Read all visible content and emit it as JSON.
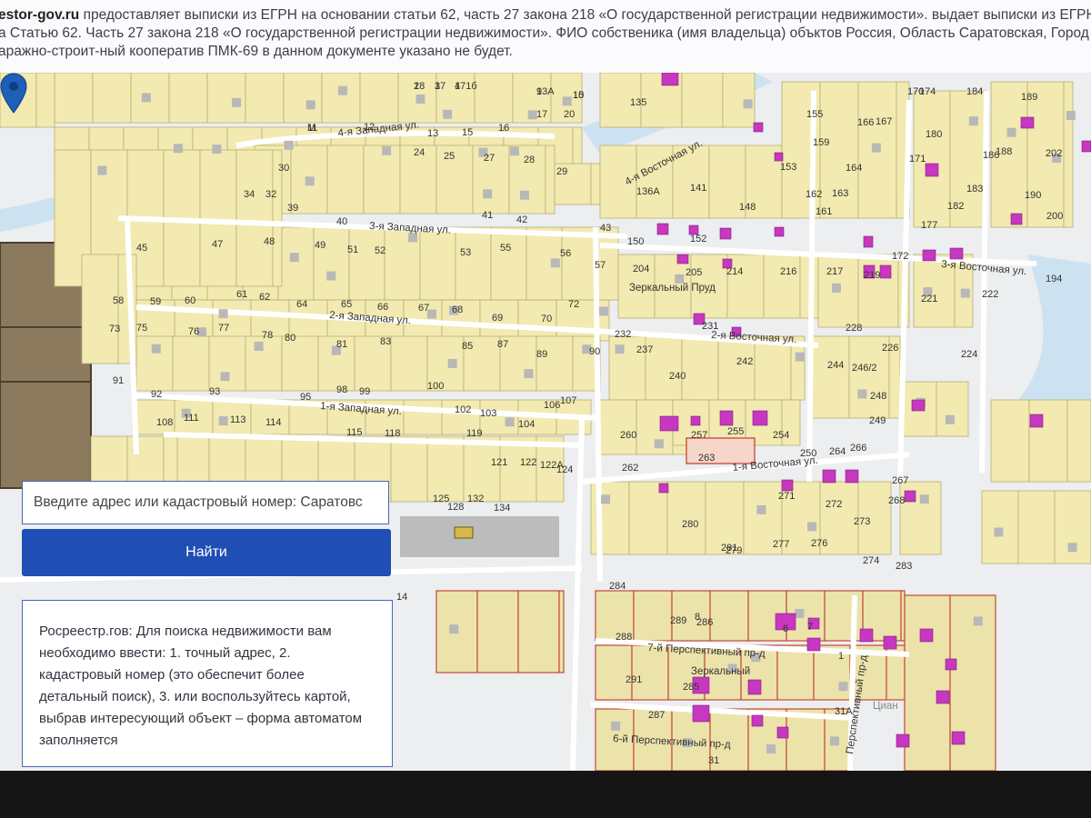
{
  "header": {
    "line1_brand": "estor-gov.ru",
    "line1_text": " предоставляет выписки из ЕГРН на основании статьи 62, часть 27 закона 218 «О государственной регистрации недвижимости». выдает выписки из ЕГРН",
    "line2_text": "а Статью 62. Часть 27 закона 218 «О государственной регистрации недвижимости». ФИО собственика (имя владельца) объктов Россия, Область Саратовская, Город",
    "line3_text": "аражно-строит-ный кооператив ПМК-69 в данном документе указано не будет."
  },
  "search": {
    "value": "Введите адрес или кадастровый номер: Саратовс",
    "button_label": "Найти"
  },
  "info_panel": {
    "text": "Росреестр.гов: Для поиска недвижимости вам необходимо ввести: 1. точный адрес, 2. кадастровый номер (это обеспечит более детальный поиск), 3. или воспользуйтесь картой, выбрав интересующий объект – форма автоматом заполняется"
  },
  "map": {
    "streets": {
      "west4": "4-я Западная ул.",
      "west3": "3-я Западная ул.",
      "west2": "2-я Западная ул.",
      "west1": "1-я Западная ул.",
      "east4": "4-я Восточная ул.",
      "east3": "3-я Восточная ул.",
      "east2": "2-я Восточная ул.",
      "east1": "1-я Восточная ул.",
      "persp7": "7-й Перспективный пр-д",
      "persp6": "6-й Перспективный пр-д",
      "persp_vert": "Перспективный пр-д"
    },
    "places": {
      "pond": "Зеркальный Пруд",
      "district": "Зеркальный",
      "watermark": "Циан"
    },
    "plot_numbers": [
      "2",
      "3",
      "4",
      "9",
      "10",
      "11",
      "12",
      "13",
      "15",
      "16",
      "17",
      "20",
      "24",
      "25",
      "27",
      "28",
      "29",
      "30",
      "32",
      "34",
      "39",
      "40",
      "41",
      "42",
      "43",
      "45",
      "47",
      "48",
      "49",
      "51",
      "52",
      "53",
      "55",
      "56",
      "57",
      "58",
      "59",
      "60",
      "61",
      "62",
      "64",
      "65",
      "66",
      "67",
      "68",
      "69",
      "70",
      "72",
      "73",
      "75",
      "76",
      "77",
      "78",
      "80",
      "81",
      "83",
      "85",
      "87",
      "89",
      "90",
      "91",
      "92",
      "93",
      "95",
      "98",
      "99",
      "100",
      "102",
      "103",
      "104",
      "106",
      "107",
      "108",
      "111",
      "113",
      "114",
      "115",
      "118",
      "119",
      "121",
      "122",
      "122A",
      "124",
      "125",
      "128",
      "132",
      "134",
      "135",
      "136A",
      "141",
      "148",
      "150",
      "152",
      "153",
      "155",
      "159",
      "161",
      "162",
      "163",
      "164",
      "166",
      "167",
      "170",
      "171",
      "172",
      "174",
      "177",
      "180",
      "182",
      "183",
      "184",
      "186",
      "188",
      "189",
      "190",
      "194",
      "200",
      "202",
      "204",
      "205",
      "214",
      "216",
      "217",
      "219",
      "221",
      "222",
      "224",
      "226",
      "228",
      "231",
      "232",
      "237",
      "240",
      "242",
      "244",
      "246/2",
      "248",
      "249",
      "250",
      "254",
      "255",
      "257",
      "260",
      "262",
      "263",
      "264",
      "266",
      "267",
      "268",
      "271",
      "272",
      "273",
      "274",
      "276",
      "277",
      "279",
      "280",
      "281",
      "283",
      "284",
      "285",
      "286",
      "287",
      "288",
      "289",
      "291",
      "31",
      "31А",
      "8",
      "1",
      "6",
      "7",
      "14",
      "18",
      "17",
      "171б",
      "13А",
      "15",
      "М"
    ]
  }
}
